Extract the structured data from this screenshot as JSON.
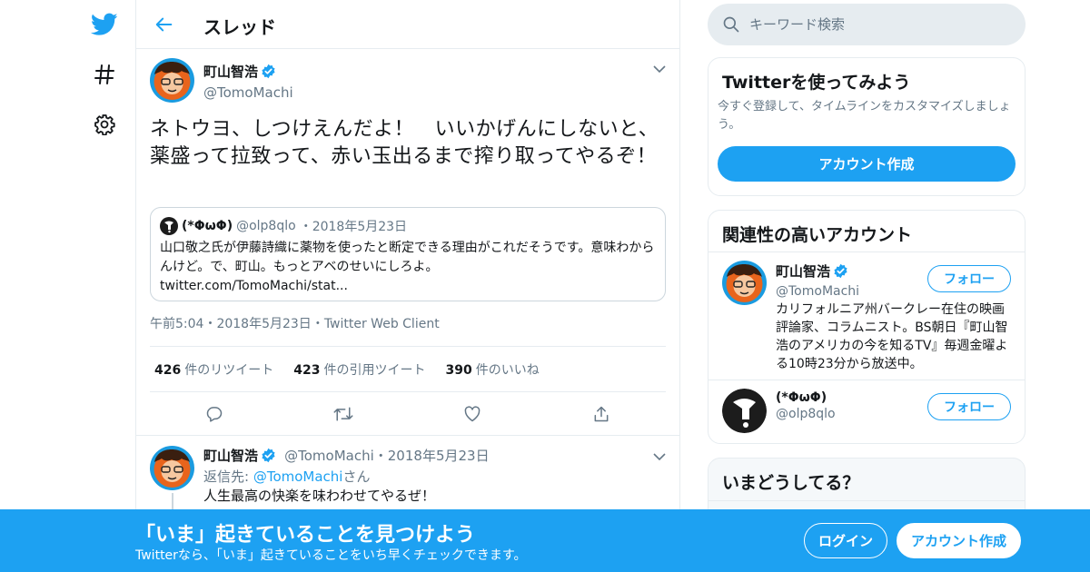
{
  "nav": {
    "items": [
      {
        "icon": "twitter-bird-icon"
      },
      {
        "icon": "hashtag-icon"
      },
      {
        "icon": "gear-icon"
      }
    ]
  },
  "header": {
    "title": "スレッド"
  },
  "main_tweet": {
    "author_name": "町山智浩",
    "author_handle": "@TomoMachi",
    "text": "ネトウヨ、しつけえんだよ！　いいかげんにしないと、薬盛って拉致って、赤い玉出るまで搾り取ってやるぞ！",
    "quote": {
      "author_name": "(*ΦωΦ)",
      "author_handle": "@olp8qlo",
      "date": "2018年5月23日",
      "text": "山口敬之氏が伊藤詩織に薬物を使ったと断定できる理由がこれだそうです。意味わからんけど。で、町山。もっとアベのせいにしろよ。",
      "link": "twitter.com/TomoMachi/stat..."
    },
    "meta": {
      "time": "午前5:04",
      "date": "2018年5月23日",
      "client": "Twitter Web Client"
    },
    "stats": {
      "retweets_count": "426",
      "retweets_label": "件のリツイート",
      "quotes_count": "423",
      "quotes_label": "件の引用ツイート",
      "likes_count": "390",
      "likes_label": "件のいいね"
    }
  },
  "reply_tweet": {
    "author_name": "町山智浩",
    "author_handle": "@TomoMachi",
    "date": "2018年5月23日",
    "reply_prefix": "返信先:",
    "reply_to": "@TomoMachi",
    "reply_suffix": "さん",
    "text": "人生最高の快楽を味わわせてやるぜ！"
  },
  "search": {
    "placeholder": "キーワード検索"
  },
  "signup_card": {
    "title": "Twitterを使ってみよう",
    "subtitle": "今すぐ登録して、タイムラインをカスタマイズしましょう。",
    "button": "アカウント作成"
  },
  "related_card": {
    "title": "関連性の高いアカウント",
    "accounts": [
      {
        "name": "町山智浩",
        "handle": "@TomoMachi",
        "bio": "カリフォルニア州バークレー在住の映画評論家、コラムニスト。BS朝日『町山智浩のアメリカの今を知るTV』毎週金曜よる10時23分から放送中。",
        "follow": "フォロー"
      },
      {
        "name": "(*ΦωΦ)",
        "handle": "@olp8qlo",
        "bio": "",
        "follow": "フォロー"
      }
    ]
  },
  "trends_card": {
    "title": "いまどうしてる？"
  },
  "banner": {
    "title": "「いま」起きていることを見つけよう",
    "subtitle": "Twitterなら、「いま」起きていることをいち早くチェックできます。",
    "login": "ログイン",
    "signup": "アカウント作成"
  },
  "colors": {
    "accent": "#1da1f2",
    "text": "#14171a",
    "muted": "#657786",
    "border": "#e6ecf0"
  }
}
